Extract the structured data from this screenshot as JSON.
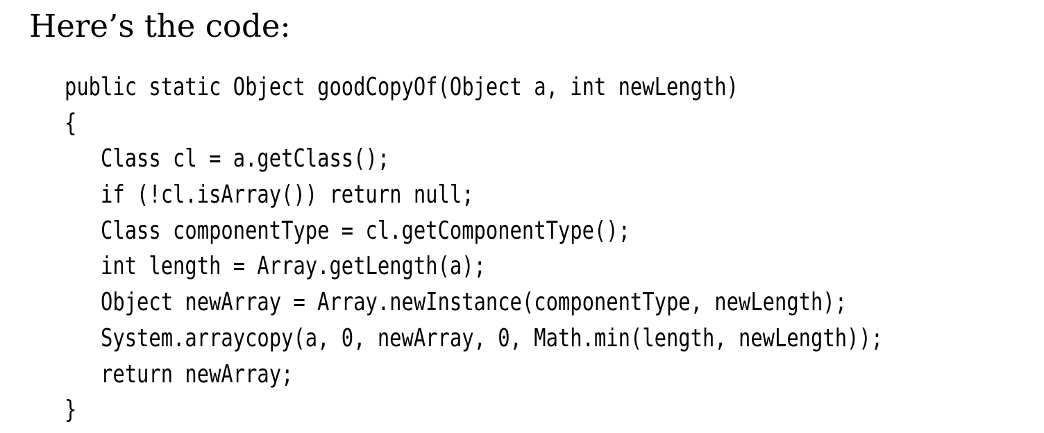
{
  "document": {
    "intro": "Here’s the code:",
    "code_lines": [
      "public static Object goodCopyOf(Object a, int newLength)",
      "{",
      "   Class cl = a.getClass();",
      "   if (!cl.isArray()) return null;",
      "   Class componentType = cl.getComponentType();",
      "   int length = Array.getLength(a);",
      "   Object newArray = Array.newInstance(componentType, newLength);",
      "   System.arraycopy(a, 0, newArray, 0, Math.min(length, newLength));",
      "   return newArray;",
      "}"
    ]
  }
}
